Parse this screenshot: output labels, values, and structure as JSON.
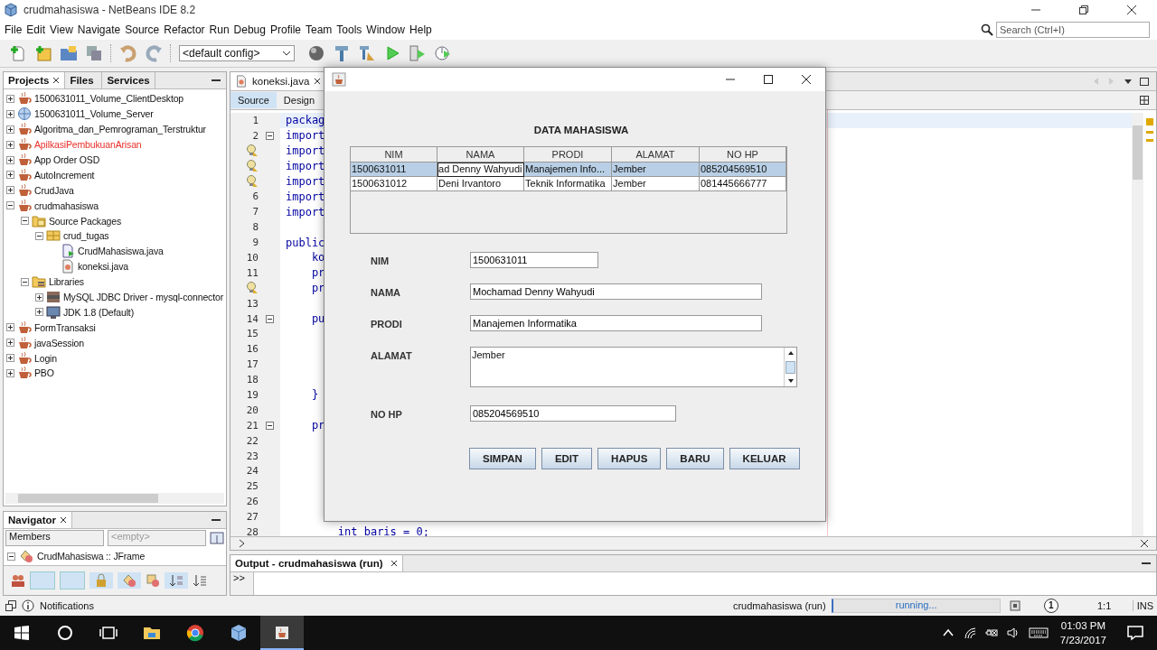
{
  "window": {
    "title": "crudmahasiswa - NetBeans IDE 8.2"
  },
  "menu": [
    "File",
    "Edit",
    "View",
    "Navigate",
    "Source",
    "Refactor",
    "Run",
    "Debug",
    "Profile",
    "Team",
    "Tools",
    "Window",
    "Help"
  ],
  "toolbar": {
    "config": "<default config>"
  },
  "search": {
    "placeholder": "Search (Ctrl+I)"
  },
  "projects_panel": {
    "tabs": [
      {
        "label": "Projects",
        "selected": true
      },
      {
        "label": "Files",
        "selected": false
      },
      {
        "label": "Services",
        "selected": false
      }
    ],
    "tree": [
      {
        "label": "1500631011_Volume_ClientDesktop",
        "kind": "project",
        "expanded": false,
        "error": false
      },
      {
        "label": "1500631011_Volume_Server",
        "kind": "web",
        "expanded": false,
        "error": false
      },
      {
        "label": "Algoritma_dan_Pemrograman_Terstruktur",
        "kind": "project",
        "expanded": false,
        "error": false
      },
      {
        "label": "ApilkasiPembukuanArisan",
        "kind": "project",
        "expanded": false,
        "error": true
      },
      {
        "label": "App Order OSD",
        "kind": "project",
        "expanded": false,
        "error": false
      },
      {
        "label": "AutoIncrement",
        "kind": "project",
        "expanded": false,
        "error": false
      },
      {
        "label": "CrudJava",
        "kind": "project",
        "expanded": false,
        "error": false
      },
      {
        "label": "crudmahasiswa",
        "kind": "project",
        "expanded": true,
        "error": false,
        "children": [
          {
            "label": "Source Packages",
            "kind": "sources",
            "expanded": true,
            "error": false,
            "children": [
              {
                "label": "crud_tugas",
                "kind": "package",
                "expanded": true,
                "error": false,
                "children": [
                  {
                    "label": "CrudMahasiswa.java",
                    "kind": "form",
                    "error": false
                  },
                  {
                    "label": "koneksi.java",
                    "kind": "class",
                    "error": false
                  }
                ]
              }
            ]
          },
          {
            "label": "Libraries",
            "kind": "libraries",
            "expanded": true,
            "error": false,
            "children": [
              {
                "label": "MySQL JDBC Driver - mysql-connector",
                "kind": "jar",
                "expanded": false,
                "error": false
              },
              {
                "label": "JDK 1.8 (Default)",
                "kind": "jdk",
                "expanded": false,
                "error": false
              }
            ]
          }
        ]
      },
      {
        "label": "FormTransaksi",
        "kind": "project",
        "expanded": false,
        "error": false
      },
      {
        "label": "javaSession",
        "kind": "project",
        "expanded": false,
        "error": false
      },
      {
        "label": "Login",
        "kind": "project",
        "expanded": false,
        "error": false
      },
      {
        "label": "PBO",
        "kind": "project",
        "expanded": false,
        "error": false
      }
    ]
  },
  "navigator": {
    "title": "Navigator",
    "filter": "Members",
    "scope": "<empty>",
    "item": "CrudMahasiswa :: JFrame"
  },
  "editor": {
    "tabs": [
      {
        "label": "koneksi.java",
        "selected": true
      }
    ],
    "views": [
      {
        "label": "Source",
        "selected": true
      },
      {
        "label": "Design",
        "selected": false
      }
    ],
    "lines": [
      {
        "number": "1",
        "code": "packag",
        "fold": false,
        "hint": false
      },
      {
        "number": "2",
        "code": "import",
        "fold": true,
        "hint": false
      },
      {
        "code": "import",
        "fold": false,
        "hint": true
      },
      {
        "code": "import",
        "fold": false,
        "hint": true
      },
      {
        "code": "import",
        "fold": false,
        "hint": true
      },
      {
        "number": "6",
        "code": "import",
        "fold": false,
        "hint": false
      },
      {
        "number": "7",
        "code": "import",
        "fold": false,
        "hint": false
      },
      {
        "number": "8",
        "fold": false,
        "hint": false
      },
      {
        "number": "9",
        "code": "public",
        "fold": false,
        "hint": false
      },
      {
        "number": "10",
        "code": "    ko",
        "fold": false,
        "hint": false
      },
      {
        "number": "11",
        "code": "    pr",
        "fold": false,
        "hint": false
      },
      {
        "code": "    pr",
        "fold": false,
        "hint": true
      },
      {
        "number": "13",
        "fold": false,
        "hint": false
      },
      {
        "number": "14",
        "code": "    pu",
        "fold": true,
        "hint": false
      },
      {
        "number": "15",
        "fold": false,
        "hint": false
      },
      {
        "number": "16",
        "fold": false,
        "hint": false
      },
      {
        "number": "17",
        "fold": false,
        "hint": false
      },
      {
        "number": "18",
        "fold": false,
        "hint": false
      },
      {
        "number": "19",
        "code": "    }",
        "fold": false,
        "hint": false
      },
      {
        "number": "20",
        "fold": false,
        "hint": false
      },
      {
        "number": "21",
        "code": "    pr",
        "fold": true,
        "hint": false
      },
      {
        "number": "22",
        "fold": false,
        "hint": false
      },
      {
        "number": "23",
        "fold": false,
        "hint": false
      },
      {
        "number": "24",
        "fold": false,
        "hint": false
      },
      {
        "number": "25",
        "fold": false,
        "hint": false
      },
      {
        "number": "26",
        "fold": false,
        "hint": false
      },
      {
        "number": "27",
        "fold": false,
        "hint": false
      },
      {
        "number": "28",
        "code": "        int baris = 0;",
        "fold": false,
        "hint": false
      }
    ]
  },
  "dialog": {
    "heading": "DATA MAHASISWA",
    "table": {
      "columns": [
        "NIM",
        "NAMA",
        "PRODI",
        "ALAMAT",
        "NO HP"
      ],
      "rows": [
        {
          "selected": true,
          "cells": [
            "1500631011",
            "ad Denny Wahyudi",
            "Manajemen Info...",
            "Jember",
            "085204569510"
          ]
        },
        {
          "selected": false,
          "cells": [
            "1500631012",
            "Deni Irvantoro",
            "Teknik Informatika",
            "Jember",
            "081445666777"
          ]
        }
      ]
    },
    "fields": [
      {
        "label": "NIM",
        "value": "1500631011",
        "kind": "text"
      },
      {
        "label": "NAMA",
        "value": "Mochamad Denny Wahyudi",
        "kind": "text"
      },
      {
        "label": "PRODI",
        "value": "Manajemen Informatika",
        "kind": "text"
      },
      {
        "label": "ALAMAT",
        "value": "Jember",
        "kind": "textarea"
      },
      {
        "label": "NO HP",
        "value": "085204569510",
        "kind": "text"
      }
    ],
    "buttons": [
      "SIMPAN",
      "EDIT",
      "HAPUS",
      "BARU",
      "KELUAR"
    ]
  },
  "output": {
    "title": "Output - crudmahasiswa (run)",
    "run_button": ">>"
  },
  "status_bar": {
    "notifications": "Notifications",
    "task": "crudmahasiswa (run)",
    "progress": "running...",
    "busy": true,
    "badge": "1",
    "position": "1:1",
    "mode": "INS"
  },
  "taskbar": {
    "time": "01:03 PM",
    "date": "7/23/2017"
  }
}
